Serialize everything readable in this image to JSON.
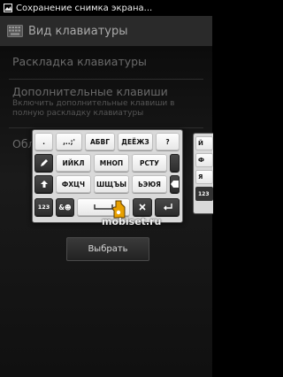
{
  "status_bar": {
    "text": "Сохранение снимка экрана..."
  },
  "header": {
    "title": "Вид клавиатуры"
  },
  "settings": {
    "layout_title": "Раскладка клавиатуры",
    "extra_keys_title": "Дополнительные клавиши",
    "extra_keys_summary": "Включить дополнительные клавиши в полную раскладку клавиатуры",
    "obl_label": "Обл"
  },
  "keyboard": {
    "row1": [
      ".",
      ",..;'",
      "АБВГ",
      "ДЕЁЖЗ",
      "?"
    ],
    "row2": [
      "ИЙКЛ",
      "МНОП",
      "РСТУ"
    ],
    "row3": [
      "ФХЦЧ",
      "ШЩЪЫ",
      "ЬЭЮЯ"
    ],
    "row4": [
      "123",
      "&☻"
    ],
    "partial": [
      "Й",
      "Ф",
      "Я",
      "123"
    ]
  },
  "select_button": {
    "label": "Выбрать"
  },
  "watermark": {
    "text": "mobiset.ru"
  },
  "colors": {
    "header_bg": "#2a2a2a",
    "key_face": "#ffffff",
    "key_dark": "#333333",
    "accent": "#e8a000"
  }
}
